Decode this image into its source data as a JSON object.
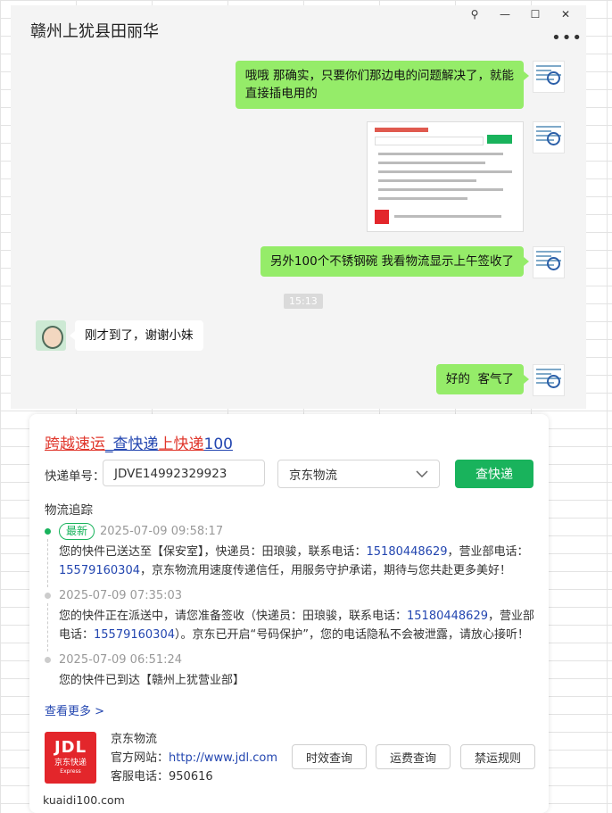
{
  "chat": {
    "title": "赣州上犹县田丽华",
    "window_controls": {
      "pin": "⚲",
      "minimize": "—",
      "maximize": "☐",
      "close": "✕"
    },
    "more_icon": "•••",
    "messages": [
      {
        "side": "right",
        "type": "text",
        "lines": [
          "哦哦 那确实，只要你们那边电的问题解决了，就能",
          "直接插电用的"
        ]
      },
      {
        "side": "right",
        "type": "image"
      },
      {
        "side": "right",
        "type": "text",
        "lines": [
          "另外100个不锈钢碗 我看物流显示上午签收了"
        ]
      },
      {
        "side": "left",
        "type": "text",
        "lines": [
          "刚才到了，谢谢小妹"
        ]
      },
      {
        "side": "right",
        "type": "text",
        "lines": [
          "好的  客气了"
        ]
      }
    ],
    "time_badge": "15:13"
  },
  "card": {
    "brand_parts": [
      "跨越速运",
      "_查快递",
      "上快递",
      "100"
    ],
    "tracking_label": "快递单号：",
    "tracking_number": "JDVE14992329923",
    "carrier_selected": "京东物流",
    "query_button": "查快递",
    "tracking_title": "物流追踪",
    "latest_tag": "最新",
    "events": [
      {
        "time": "2025-07-09 09:58:17",
        "desc_a": "您的快件已送达至【保安室】，快递员：田琅骏，联系电话：",
        "phone1": "15180448629",
        "desc_b": "，营业部电话：",
        "phone2": "15579160304",
        "desc_c": "，京东物流用速度传递信任，用服务守护承诺，期待与您共赴更多美好！"
      },
      {
        "time": "2025-07-09 07:35:03",
        "desc_a": "您的快件正在派送中，请您准备签收（快递员：田琅骏，联系电话：",
        "phone1": "15180448629",
        "desc_b": "，营业部电话：",
        "phone2": "15579160304",
        "desc_c": "）。京东已开启“号码保护”，您的电话隐私不会被泄露，请放心接听！"
      },
      {
        "time": "2025-07-09 06:51:24",
        "desc": "您的快件已到达【赣州上犹营业部】"
      }
    ],
    "more_link": "查看更多 >",
    "logo": {
      "main": "JDL",
      "sub": "京东快递",
      "tiny": "Express"
    },
    "carrier_name": "京东物流",
    "website_label": "官方网站：",
    "website_url": "http://www.jdl.com",
    "service_label": "客服电话：",
    "service_phone": "950616",
    "buttons": [
      "时效查询",
      "运费查询",
      "禁运规则"
    ],
    "footer": "kuaidi100.com"
  }
}
